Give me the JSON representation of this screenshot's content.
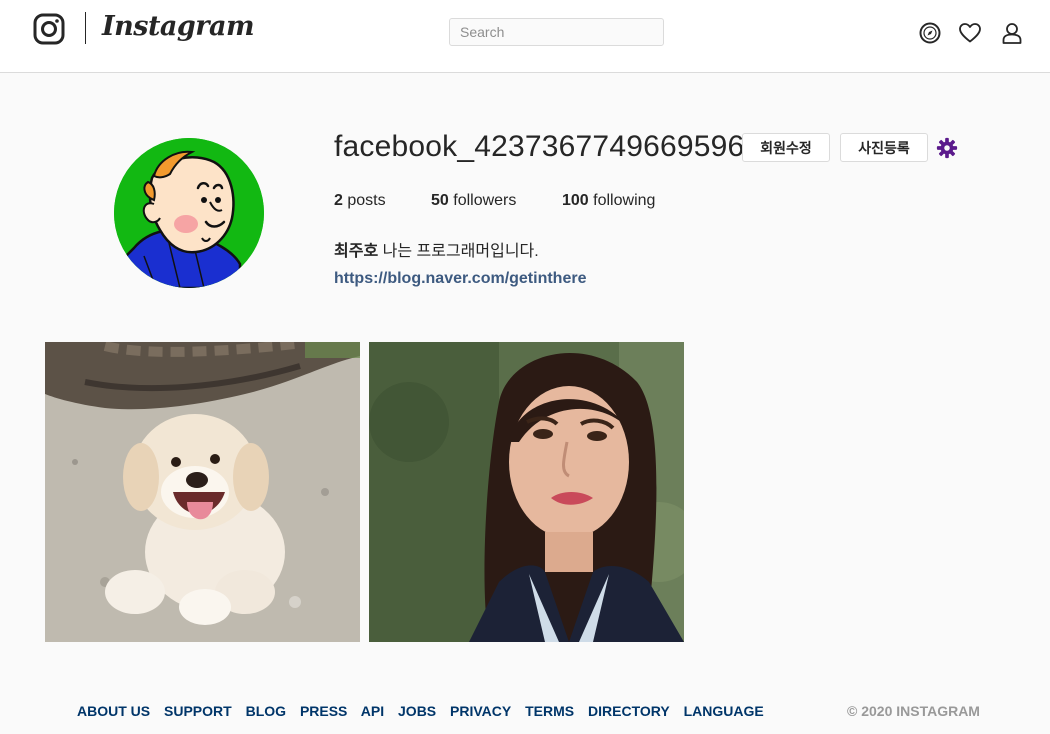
{
  "header": {
    "logo_text": "Instagram",
    "search_placeholder": "Search",
    "icons": [
      "instagram-camera-icon",
      "compass-icon",
      "heart-icon",
      "user-icon"
    ]
  },
  "profile": {
    "username": "facebook_4237367749669596",
    "edit_button": "회원수정",
    "upload_button": "사진등록",
    "settings_icon": "gear-icon",
    "stats": {
      "posts_count": "2",
      "posts_label": "posts",
      "followers_count": "50",
      "followers_label": "followers",
      "following_count": "100",
      "following_label": "following"
    },
    "bio_name": "최주호",
    "bio_text": "나는 프로그래머입니다.",
    "website": "https://blog.naver.com/getinthere"
  },
  "posts": [
    {
      "subject": "white puppy photo"
    },
    {
      "subject": "woman portrait photo"
    }
  ],
  "footer": {
    "links": [
      "ABOUT US",
      "SUPPORT",
      "BLOG",
      "PRESS",
      "API",
      "JOBS",
      "PRIVACY",
      "TERMS",
      "DIRECTORY",
      "LANGUAGE"
    ],
    "copyright": "© 2020 INSTAGRAM"
  },
  "colors": {
    "link": "#3d5a80",
    "footer_link": "#003569",
    "gear": "#5b1a8c",
    "avatar_bg": "#12b812"
  }
}
